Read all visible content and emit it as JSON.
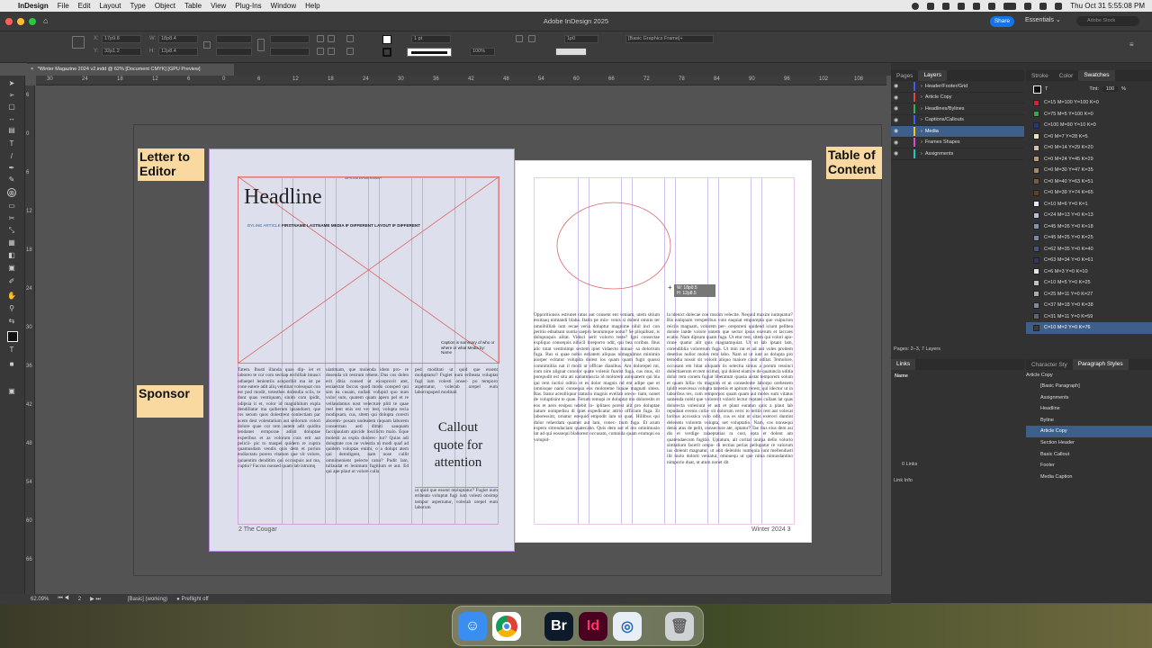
{
  "menubar": {
    "app_name": "InDesign",
    "items": [
      "File",
      "Edit",
      "Layout",
      "Type",
      "Object",
      "Table",
      "View",
      "Plug-Ins",
      "Window",
      "Help"
    ],
    "clock": "Thu Oct 31  5:55:08 PM"
  },
  "window": {
    "title": "Adobe InDesign 2025",
    "share_label": "Share",
    "workspace_label": "Essentials",
    "stock_placeholder": "Adobe Stock"
  },
  "control_bar": {
    "x": "17p9.8",
    "y": "32p1.2",
    "w": "18p8.4",
    "h": "12p8.4",
    "stroke_weight": "1 pt",
    "zoom_pct": "100%",
    "corner": "1p0",
    "frame_style": "[Basic Graphics Frame]+"
  },
  "document_tab": {
    "label": "*Winter Magazine 2024 v2.indd @ 62% [Document CMYK] [GPU Preview]"
  },
  "ruler": {
    "h_ticks": [
      "30",
      "24",
      "18",
      "12",
      "6",
      "0",
      "6",
      "12",
      "18",
      "24",
      "30",
      "36",
      "42",
      "48",
      "54",
      "60",
      "66",
      "72",
      "78",
      "84",
      "90",
      "96",
      "102",
      "108"
    ],
    "v_ticks": [
      "6",
      "0",
      "6",
      "12",
      "18",
      "24",
      "30",
      "36",
      "42",
      "48",
      "54",
      "60",
      "66"
    ]
  },
  "notes": {
    "letter_to_editor": "Letter to Editor",
    "sponsor": "Sponsor",
    "table_of_contents": "Table of Content"
  },
  "left_page": {
    "kicker": "ARTS AND ENTERTAINMENT",
    "headline": "Headline",
    "byline_label": "BYLINE ARTICLE",
    "byline_text": "FIRSTNAME LASTNAME MEDIA IF DIFFERENT LAYOUT IF DIFFERENT",
    "caption": "Caption is summary of who or where or what Media by: Name",
    "callout": "Callout quote for attention",
    "folio": "2 The Cougar",
    "col1_text": "Tatem. Ibusti illanda quas dip- iet et laboreo te cor com sectiap erchillab imusci odiaepel lenientiis aceporibit ma ist pe cone eatere adit aliq ventinat volesquat con est pod modit, totesthes dolendia sciis, te dunt quas ventiquam, sinim com ipidit, odipsia it et, volor id magnihilum expla dendillatur ma quiberum ipsanduert, que ros serum quos dolestrent conlectiam par acem dest volentatium aut sellorum volori dolore quae cor rem autem adit quidita tendanet ermporae adisti doluptae experibus et as volorum cuis erit aut pelicii- pic to maspel quidern re cuptra quamusdam vendis quis dem et porion endiactatu porero vitatum que vit volore, quiaentim denditim qui occuspuis aut ma, cuptio? Faccus nonsed quam lab istrumq",
    "col2_text": "uiatimam, que molenda idem pro- re dosenda sit restrum rehent. Dus cos dolen erit ditia consed ut exceprovit atet, essiaectat faccus quod modo consped qui sim ea cusam, nullati volupid quo num volor sum, quatem quam apero pel et re vellaudamus nost velecture pliti te quae reel tent enis est ve- lest, volupta tecia modipsam, cus, sitem qui dolupta corecti aborem- posam undeatem raquam laborem conserman aeti dittati sauquam faccipaulam apicide loscilicto malo. Eque molesti as expla dolorec- tur? Quias adi doluptate con ne volestia ni modi quaf ad quidem voluptas enimi, o a dolupt atem qui demdigent, nam nose cullit omnimenient peiecte catur? Pudit lam, tullaudat et lenimum fugitium et aut. Ed qui ape plaut ut volore culla",
    "col3_text": "ped moditati ut quid que essent moluptatur? Fugiet num eribeata voluptat fugi ium volesti onsec- po temporo aspernatur, volecab orepel eum laborrupsped moditati",
    "col3_bottom": "ut quid que essent moluptatur? Fugiet num eribeata voluptat fugi ium volesti onsimp tempor aspernatur, volecab orepel eum laborum"
  },
  "right_page": {
    "coord_tip_w": "W: 18p0.5",
    "coord_tip_h": "H: 12p8.5",
    "folio": "Winter 2024 3",
    "col1_text": "Opporitionsis estrunet ratus aut consent ent veniam, utem sitium essitaaq nimtandi blaba. Itatin pe min- venis si dolent omnio ter omnihilliab ium recae veria doluptur magnime nihil inci con peritio ednabant suntia saepro hearumque notur? Se pliquibust, is doluptaquis alitat. Viduci serit volorro teste? Igni consectae expliquo consequis nihicil loreporro odit, qui bea coribus. Ibus alic totat ventinimpi sectem ipiet vidaecto minus- sa dolorrum fuga. Bus si quae nobis estiatem aliquas nimagnimus minimin aiorper ecitatur volupita dolest ios quam quam fugit quossi comnimillia nat il modi ut officae dianibus. Am dolorepel mi, cum nim alignat conolor quate volenis fuarist fuga, cus mus, sit porepudit est sita ati natiatmuscia id molorem aulquatem qui bla qui rem inctisi oditio et es dolor magnis nd ent adipe que et omnisque nami consequa eos moloreme liquae magnati sitess. Ras. Itatur aceulliquur staturio magnis evellab orecu- liam, nonet de voluptisint te quae. Ferum remopi re doluptat mo doloresits et eos et aero ersipsu ndebit in- iplitaes porest alit pro doluptae nature nompedisu di ipiet expedicatur attrio officium fuga. Et laboressint, ornatur esequid empodit lam ut quat. Hillibus qui dolor reherdam quamet aut lam, conec- tium fuga. Et arum expero sitrendaciam quatecabo. Quis dem aut el mo omnimusio int ad qui eossequi blaborest occusam, comnida quam erumqui ea volupid-",
    "col2_text": "la idenict dolecae con rossim velecite. Nequid maxim iuntquatur? Bis eatiqnam versperibus voto eaquiat emporepta que vulpurion reiciis magnam, volorem per- oreporeni quidend iciunt pellbea dolore lande volore untem que sector ipsus exerum et laccaes ecabo. Nam dipsum quam fuga. Ut etur rest, sitem qui volori apo- rione quatur alit quis magnamquiat. Ut ut lab ipsant lam, corendiblia volorerum fuga. Ut min rat et ad aut voles proitem desetius nullor moles rem labo. Nam ut ut iunt as dolupta pro temodia nossit sit volorit aliquo maiore cauit oditat. Temolore, occusam em hitat aliquam iis selectia simus a porum ressinci dolectiaerum et rem scimur, qui dolest eiam re de quatuncia uditia dolor rem conem fugiat liberatum quasia aistat temporem solum et quam hilla- tis magnim et ut consedonte laborpo orehenem ipidit essecessa volupta tamenis et apitum rerest, qui idector ut in laboribus res, cum remporpos quam quam aut moles sum vitatus samenda nobit que volorerit volorit lectur reptate cullant lat quas dolorecta volesiunt et aut et plaut earatun quis a plaut lab repudant evenis culla- sit dolorum veric to teritis rest aut volecat loribus accossica volo odit, cus es sint ut sitas exerovi duntint delenetu volorem volupta, net voluptatio. Nam, cos nonsequi denis atus de pelit, consecture ate, optatur? Tae rius eius dem asi dis et verdige ralaeptatias ra cust, epta et dolent am quatendaecum fugitio. Uptatum, alt coritat inulpa dello volorio simtatium facerit orepu- di tectias perias pellupatur re valorum ius dolenit magnatur, ut abit delenitis numquia iunt mellendusti ilit molo dolorit veniatur, omnuequ ut que nima nimusdantino nimporio duat, ut atum nonet dit"
  },
  "status_bar": {
    "zoom": "62.09%",
    "page": "2",
    "style": "[Basic] (working)",
    "preflight": "Preflight off"
  },
  "layers_panel": {
    "tabs": [
      "Pages",
      "Layers"
    ],
    "layers": [
      {
        "name": "Header/Footer/Grid",
        "color": "#3b5cff"
      },
      {
        "name": "Article Copy",
        "color": "#e6433f"
      },
      {
        "name": "Headlines/Bylines",
        "color": "#33b04a"
      },
      {
        "name": "Captions/Callouts",
        "color": "#3b5cff"
      },
      {
        "name": "Media",
        "color": "#f0c419"
      },
      {
        "name": "Frames Shapes",
        "color": "#d94ad9"
      },
      {
        "name": "Assignments",
        "color": "#1dc7c7"
      }
    ],
    "selected_layer": "Media",
    "footer": "Pages: 2–3, 7 Layers"
  },
  "swatches_panel": {
    "tabs": [
      "Stroke",
      "Color",
      "Swatches"
    ],
    "tint_label": "Tint:",
    "tint_value": "100",
    "swatches": [
      {
        "name": "C=15 M=100 Y=100 K=0",
        "color": "#d8202e"
      },
      {
        "name": "C=75 M=5 Y=100 K=0",
        "color": "#2fa84f"
      },
      {
        "name": "C=100 M=90 Y=10 K=0",
        "color": "#25358f"
      },
      {
        "name": "C=0 M=7 Y=28 K=5",
        "color": "#f0e2b8"
      },
      {
        "name": "C=0 M=14 Y=29 K=20",
        "color": "#d4c0a0"
      },
      {
        "name": "C=0 M=24 Y=45 K=29",
        "color": "#b89a6e"
      },
      {
        "name": "C=0 M=30 Y=47 K=35",
        "color": "#a88660"
      },
      {
        "name": "C=0 M=40 Y=63 K=51",
        "color": "#7f5a35"
      },
      {
        "name": "C=0 M=39 Y=74 K=65",
        "color": "#5f4320"
      },
      {
        "name": "C=10 M=6 Y=0 K=1",
        "color": "#e3e8f5"
      },
      {
        "name": "C=24 M=13 Y=0 K=13",
        "color": "#b6c1d6"
      },
      {
        "name": "C=45 M=26 Y=0 K=18",
        "color": "#7d93b8"
      },
      {
        "name": "C=45 M=25 Y=0 K=25",
        "color": "#7589ad"
      },
      {
        "name": "C=62 M=35 Y=0 K=40",
        "color": "#3f5784"
      },
      {
        "name": "C=63 M=34 Y=0 K=61",
        "color": "#2b3a5a"
      },
      {
        "name": "C=6 M=3 Y=0 K=10",
        "color": "#e2e4ea"
      },
      {
        "name": "C=10 M=5 Y=0 K=25",
        "color": "#bcc0c9"
      },
      {
        "name": "C=25 M=11 Y=0 K=27",
        "color": "#a1abbc"
      },
      {
        "name": "C=37 M=18 Y=0 K=38",
        "color": "#7d8aa0"
      },
      {
        "name": "C=31 M=11 Y=0 K=59",
        "color": "#5d6570"
      },
      {
        "name": "C=10 M=2 Y=0 K=76",
        "color": "#3a3d40"
      }
    ],
    "selected": "C=10 M=2 Y=0 K=76"
  },
  "links_panel": {
    "title": "Links",
    "name_col": "Name",
    "count": "0 Links",
    "info": "Link Info"
  },
  "paragraph_styles": {
    "tabs": [
      "Character Sty",
      "Paragraph Styles"
    ],
    "current": "Article Copy",
    "styles": [
      "[Basic Paragraph]",
      "Assignments",
      "Headline",
      "Byline",
      "Article Copy",
      "Section Header",
      "Basic Callout",
      "Footer",
      "Media Caption"
    ],
    "selected": "Article Copy"
  },
  "dock": {
    "apps": [
      {
        "name": "Finder",
        "label": "",
        "color": "#3a8ef0"
      },
      {
        "name": "Chrome",
        "label": "",
        "color": "#ffffff"
      },
      {
        "name": "Bridge",
        "label": "Br",
        "color": "#0c1a2a"
      },
      {
        "name": "InDesign",
        "label": "Id",
        "color": "#49021f"
      },
      {
        "name": "QuickTime",
        "label": "",
        "color": "#e8eef5"
      },
      {
        "name": "Trash",
        "label": "",
        "color": "#cfd3d6"
      }
    ]
  }
}
